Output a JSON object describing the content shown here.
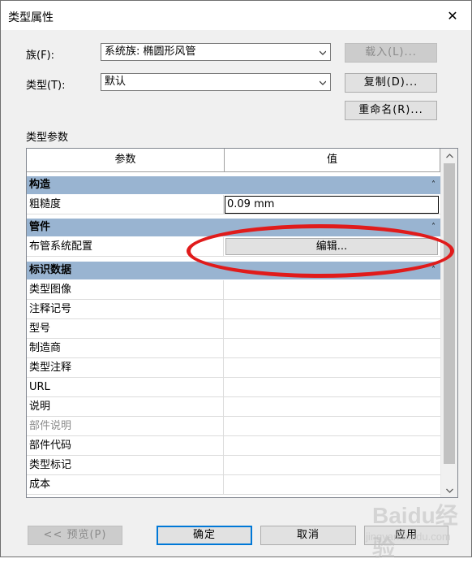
{
  "window": {
    "title": "类型属性",
    "close_glyph": "✕"
  },
  "form": {
    "family_label": "族(F):",
    "family_value": "系统族: 椭圆形风管",
    "type_label": "类型(T):",
    "type_value": "默认",
    "load_button": "载入(L)...",
    "duplicate_button": "复制(D)...",
    "rename_button": "重命名(R)..."
  },
  "params": {
    "section_label": "类型参数",
    "col_param": "参数",
    "col_value": "值",
    "groups": [
      {
        "name": "构造",
        "rows": [
          {
            "name": "粗糙度",
            "value": "0.09 mm"
          }
        ]
      },
      {
        "name": "管件",
        "rows": [
          {
            "name": "布管系统配置",
            "value": "编辑..."
          }
        ]
      },
      {
        "name": "标识数据",
        "rows": [
          {
            "name": "类型图像",
            "value": ""
          },
          {
            "name": "注释记号",
            "value": ""
          },
          {
            "name": "型号",
            "value": ""
          },
          {
            "name": "制造商",
            "value": ""
          },
          {
            "name": "类型注释",
            "value": ""
          },
          {
            "name": "URL",
            "value": ""
          },
          {
            "name": "说明",
            "value": ""
          },
          {
            "name": "部件说明",
            "value": ""
          },
          {
            "name": "部件代码",
            "value": ""
          },
          {
            "name": "类型标记",
            "value": ""
          },
          {
            "name": "成本",
            "value": ""
          }
        ]
      }
    ]
  },
  "footer": {
    "preview_button": "<< 预览(P)",
    "ok_button": "确定",
    "cancel_button": "取消",
    "apply_button": "应用"
  },
  "watermark": {
    "brand": "Baidu经验",
    "url": "jingyan.baidu.com"
  },
  "colors": {
    "group_header": "#99b4d1",
    "annotation": "#e01b1b",
    "focus": "#0078d7"
  }
}
